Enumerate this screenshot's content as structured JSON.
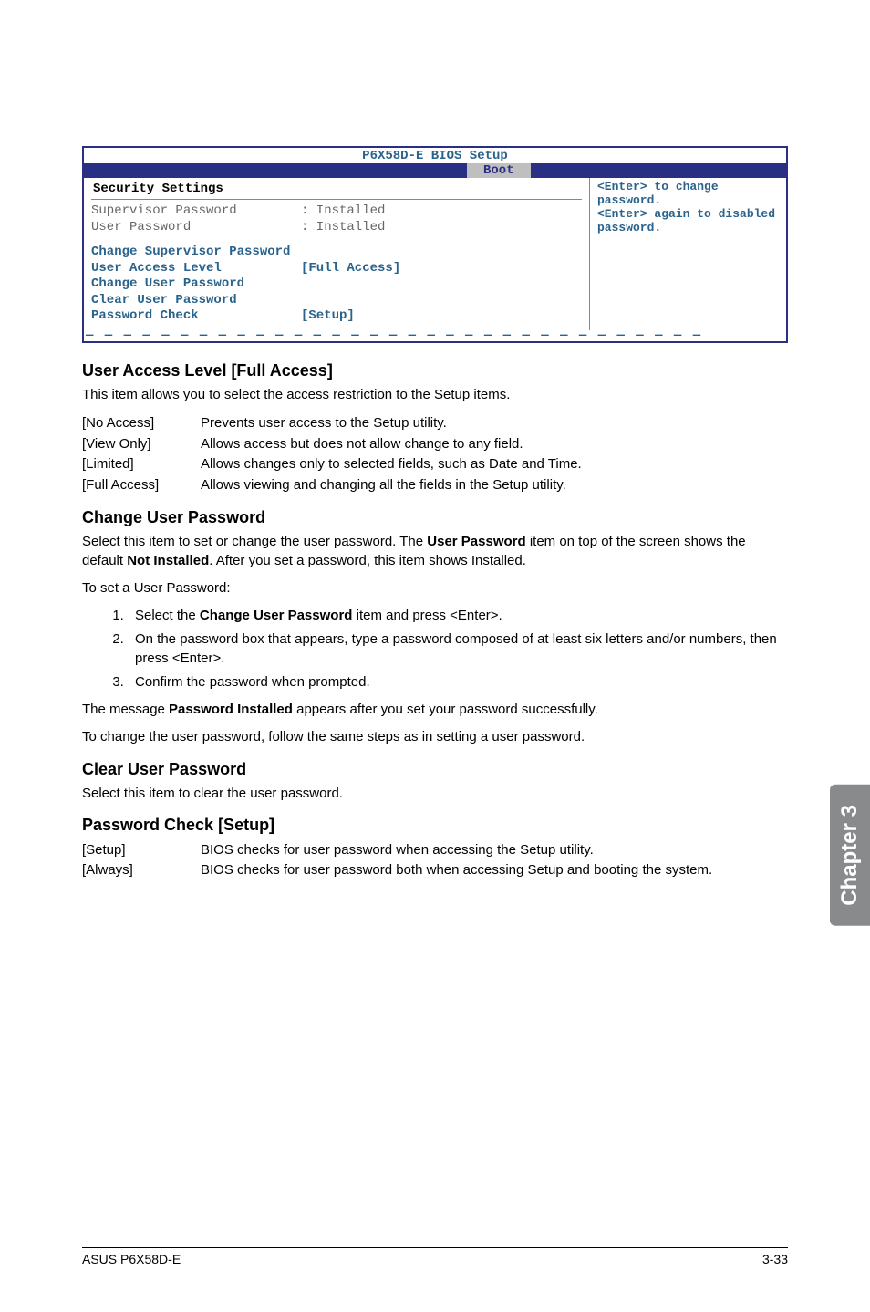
{
  "bios": {
    "title": "P6X58D-E BIOS Setup",
    "tab": "Boot",
    "heading": "Security Settings",
    "rows_static": [
      {
        "label": "Supervisor Password",
        "value": ": Installed"
      },
      {
        "label": "User Password",
        "value": ": Installed"
      }
    ],
    "rows_editable": {
      "r0": "Change Supervisor Password",
      "r1_label": "User Access Level",
      "r1_value": "[Full Access]",
      "r2": "Change User Password",
      "r3": "Clear User Password",
      "r4_label": "Password Check",
      "r4_value": "[Setup]"
    },
    "help": "<Enter> to change password.\n<Enter> again to disabled password."
  },
  "sections": {
    "ual": {
      "title": "User Access Level [Full Access]",
      "lead": "This item allows you to select the access restriction to the Setup items.",
      "defs": [
        {
          "term": "[No Access]",
          "desc": "Prevents user access to the Setup utility."
        },
        {
          "term": "[View Only]",
          "desc": "Allows access but does not allow change to any field."
        },
        {
          "term": "[Limited]",
          "desc": "Allows changes only to selected fields, such as Date and Time."
        },
        {
          "term": "[Full Access]",
          "desc": "Allows viewing and changing all the fields in the Setup utility."
        }
      ]
    },
    "cup": {
      "title": "Change User Password",
      "p1a": "Select this item to set or change the user password. The ",
      "p1b": "User Password",
      "p1c": " item on top of the screen shows the default ",
      "p1d": "Not Installed",
      "p1e": ". After you set a password, this item shows Installed.",
      "p2": "To set a User Password:",
      "steps": {
        "s1a": "Select the ",
        "s1b": "Change User Password",
        "s1c": " item and press <Enter>.",
        "s2": "On the password box that appears, type a password composed of at least six letters and/or numbers, then press <Enter>.",
        "s3": "Confirm the password when prompted."
      },
      "p3a": "The message ",
      "p3b": "Password Installed",
      "p3c": " appears after you set your password successfully.",
      "p4": "To change the user password, follow the same steps as in setting a user password."
    },
    "clup": {
      "title": "Clear User Password",
      "p1": "Select this item to clear the user password."
    },
    "pcs": {
      "title": "Password Check [Setup]",
      "defs": [
        {
          "term": "[Setup]",
          "desc": "BIOS checks for user password when accessing the Setup utility."
        },
        {
          "term": "[Always]",
          "desc": "BIOS checks for user password both when accessing Setup and booting the system."
        }
      ]
    }
  },
  "side_tab": "Chapter 3",
  "footer": {
    "left": "ASUS P6X58D-E",
    "right": "3-33"
  }
}
